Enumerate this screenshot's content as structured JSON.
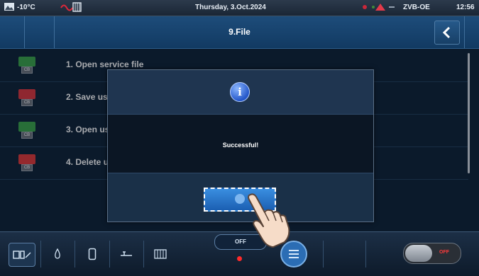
{
  "status": {
    "temperature": "-10°C",
    "date": "Thursday, 3.Oct.2024",
    "device": "ZVB-OE",
    "time": "12:56"
  },
  "header": {
    "title": "9.File"
  },
  "list": {
    "items": [
      {
        "label": "1. Open service file",
        "icon": "open-service-file-icon"
      },
      {
        "label": "2. Save user file",
        "icon": "save-user-file-icon"
      },
      {
        "label": "3. Open user file",
        "icon": "open-user-file-icon"
      },
      {
        "label": "4. Delete user file",
        "icon": "delete-user-file-icon"
      }
    ]
  },
  "dialog": {
    "icon": "info-icon",
    "message": "Successful!",
    "ok_icon": "check-icon"
  },
  "bottombar": {
    "mode_label": "OFF",
    "toggle_label": "OFF"
  },
  "colors": {
    "header_blue": "#1d4c7a",
    "background": "#0f2236",
    "ok_button": "#2a7fd4",
    "off_red": "#ff3b3b"
  }
}
